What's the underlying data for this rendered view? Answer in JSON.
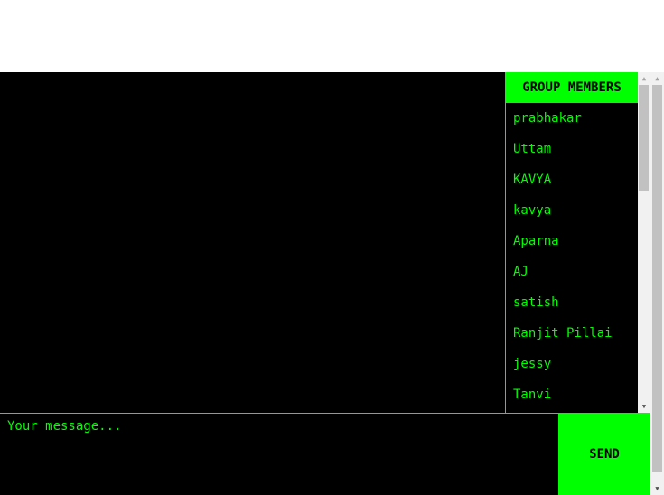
{
  "members_panel": {
    "header": "GROUP MEMBERS",
    "members": [
      "prabhakar",
      "Uttam",
      "KAVYA",
      "kavya",
      "Aparna",
      "AJ",
      "satish",
      "Ranjit Pillai",
      "jessy",
      "Tanvi"
    ]
  },
  "composer": {
    "placeholder": "Your message...",
    "send_label": "SEND"
  },
  "icons": {
    "scroll_up": "scroll-up-arrow-icon",
    "scroll_down": "scroll-down-arrow-icon"
  },
  "colors": {
    "accent": "#00ff00",
    "background": "#000000",
    "page": "#ffffff"
  }
}
